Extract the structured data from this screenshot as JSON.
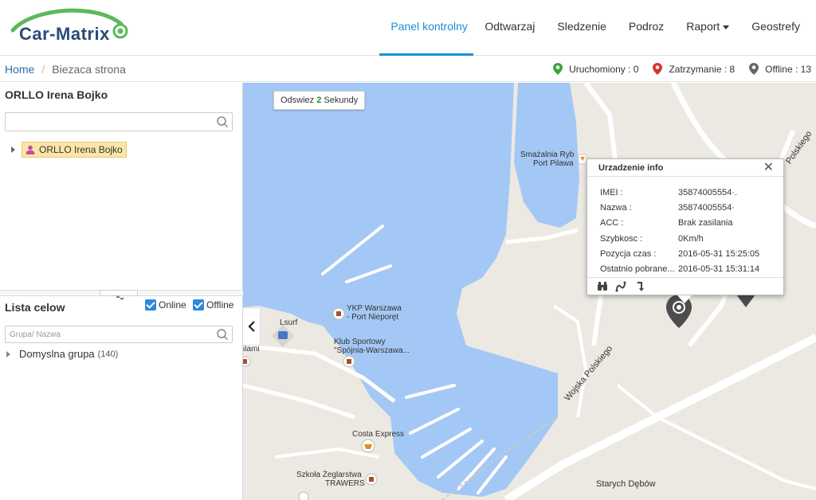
{
  "app": {
    "logo_text": "Car-Matrix"
  },
  "nav": [
    {
      "label": "Panel kontrolny",
      "active": true
    },
    {
      "label": "Odtwarzaj"
    },
    {
      "label": "Sledzenie"
    },
    {
      "label": "Podroz"
    },
    {
      "label": "Raport",
      "dropdown": true
    },
    {
      "label": "Geostrefy"
    }
  ],
  "breadcrumb": {
    "home": "Home",
    "current": "Biezaca strona"
  },
  "status": {
    "running": "Uruchomiony : 0",
    "stopped": "Zatrzymanie : 8",
    "offline": "Offline : 13",
    "colors": {
      "running": "#3aa635",
      "stopped": "#d9322b",
      "offline": "#666666"
    }
  },
  "left": {
    "title": "ORLLO Irena Bojko",
    "search_placeholder": "",
    "tree_node": "ORLLO Irena Bojko",
    "lista_title": "Lista celow",
    "online_label": "Online",
    "offline_label": "Offline",
    "group_search_placeholder": "Grupa/ Nazwa",
    "group_name": "Domyslna grupa",
    "group_count": "(140)"
  },
  "map": {
    "refresh_prefix": "Odswiez ",
    "refresh_value": "2",
    "refresh_suffix": " Sekundy",
    "labels": {
      "smazalnia1": "Smażalnia Ryb",
      "smazalnia2": "Port Pilawa",
      "ykp1": "YKP Warszawa",
      "ykp2": "- Port Nieporęt",
      "klub1": "Klub Sportowy",
      "klub2": "\"Spójnia-Warszawa...",
      "lsurf": "Lsurf",
      "ilami": "ilami",
      "costa": "Costa Express",
      "szkola1": "Szkoła Żeglarstwa",
      "szkola2": "TRAWERS",
      "starych": "Starych Dębów",
      "wojska": "Wojska Polskiego",
      "polskiego": "Polskiego"
    },
    "water_color": "#a3c8f5",
    "land_color": "#ece9e3"
  },
  "popup": {
    "title": "Urzadzenie info",
    "rows": [
      {
        "key": "IMEI :",
        "value": "35874005554·."
      },
      {
        "key": "Nazwa :",
        "value": "35874005554·"
      },
      {
        "key": "ACC :",
        "value": "Brak zasilania"
      },
      {
        "key": "Szybkosc :",
        "value": "0Km/h"
      },
      {
        "key": "Pozycja czas :",
        "value": "2016-05-31 15:25:05"
      },
      {
        "key": "Ostatnio pobrane...",
        "value": "2016-05-31 15:31:14"
      }
    ]
  }
}
